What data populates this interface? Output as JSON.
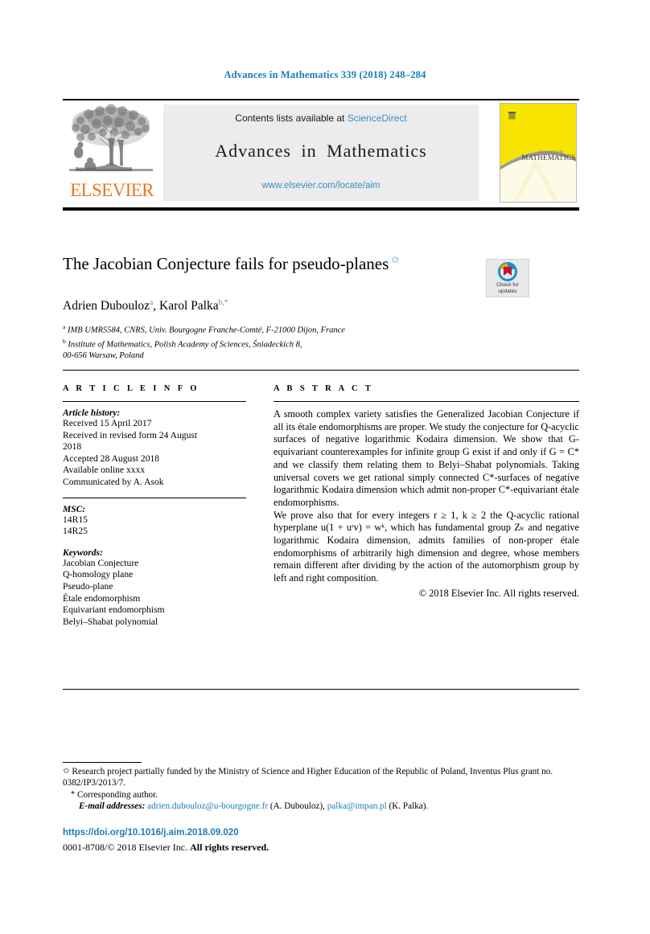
{
  "running_head": "Advances in Mathematics 339 (2018) 248–284",
  "masthead": {
    "publisher": "ELSEVIER",
    "tree_logo_alt": "elsevier-tree-logo",
    "contents_prefix": "Contents lists available at ",
    "contents_link": "ScienceDirect",
    "journal_name": "Advances in Mathematics",
    "journal_url": "www.elsevier.com/locate/aim",
    "cover": {
      "title_small": "ADVANCES IN",
      "title_main": "MATHEMATICS",
      "letter": "A",
      "bg_color": "#f7e400",
      "lower_color": "#fbf6cf"
    }
  },
  "article": {
    "title": "The Jacobian Conjecture fails for pseudo-planes",
    "title_footnote_mark": "✩",
    "authors_plain": "Adrien Dubouloz",
    "authors": [
      {
        "name": "Adrien Dubouloz",
        "marks": "a"
      },
      {
        "name": "Karol Palka",
        "marks": "b,*"
      }
    ],
    "affiliations": [
      {
        "mark": "a",
        "text": "IMB UMR5584, CNRS, Univ. Bourgogne Franche-Comté, F-21000 Dijon, France"
      },
      {
        "mark": "b",
        "text": "Institute of Mathematics, Polish Academy of Sciences, Śniadeckich 8,"
      },
      {
        "mark": "",
        "text": "00-656 Warsaw, Poland"
      }
    ],
    "crossmark": {
      "line1": "Check for",
      "line2": "updates"
    }
  },
  "article_info": {
    "heading": "A R T I C L E   I N F O",
    "history_label": "Article history:",
    "history": [
      "Received 15 April 2017",
      "Received in revised form 24 August",
      "2018",
      "Accepted 28 August 2018",
      "Available online xxxx",
      "Communicated by A. Asok"
    ],
    "msc_label": "MSC:",
    "msc": [
      "14R15",
      "14R25"
    ],
    "keywords_label": "Keywords:",
    "keywords": [
      "Jacobian Conjecture",
      "Q-homology plane",
      "Pseudo-plane",
      "Étale endomorphism",
      "Equivariant endomorphism",
      "Belyi–Shabat polynomial"
    ]
  },
  "abstract": {
    "heading": "A B S T R A C T",
    "paragraphs": [
      "A smooth complex variety satisfies the Generalized Jacobian Conjecture if all its étale endomorphisms are proper. We study the conjecture for Q-acyclic surfaces of negative logarithmic Kodaira dimension. We show that G-equivariant counterexamples for infinite group G exist if and only if G = C* and we classify them relating them to Belyi–Shabat polynomials. Taking universal covers we get rational simply connected C*-surfaces of negative logarithmic Kodaira dimension which admit non-proper C*-equivariant étale endomorphisms.",
      "We prove also that for every integers r ≥ 1, k ≥ 2 the Q-acyclic rational hyperplane u(1 + uʳv) = wᵏ, which has fundamental group Zₖ and negative logarithmic Kodaira dimension, admits families of non-proper étale endomorphisms of arbitrarily high dimension and degree, whose members remain different after dividing by the action of the automorphism group by left and right composition."
    ],
    "copyright": "© 2018 Elsevier Inc. All rights reserved."
  },
  "footnotes": {
    "funding_mark": "✩",
    "funding": "Research project partially funded by the Ministry of Science and Higher Education of the Republic of Poland, Inventus Plus grant no. 0382/IP3/2013/7.",
    "corresponding_mark": "*",
    "corresponding": "Corresponding author.",
    "email_label": "E-mail addresses:",
    "emails": [
      {
        "address": "adrien.dubouloz@u-bourgogne.fr",
        "owner": "(A. Dubouloz)"
      },
      {
        "address": "palka@impan.pl",
        "owner": "(K. Palka)"
      }
    ]
  },
  "publication": {
    "doi": "https://doi.org/10.1016/j.aim.2018.09.020",
    "issn_line_plain": "0001-8708/",
    "issn_line_rest": "© 2018 Elsevier Inc. ",
    "issn_line_bold": "All rights reserved."
  },
  "colors": {
    "link": "#1a7db6",
    "science_direct": "#3a8fc4",
    "elsevier_orange": "#E87722",
    "band": "#ececec"
  }
}
